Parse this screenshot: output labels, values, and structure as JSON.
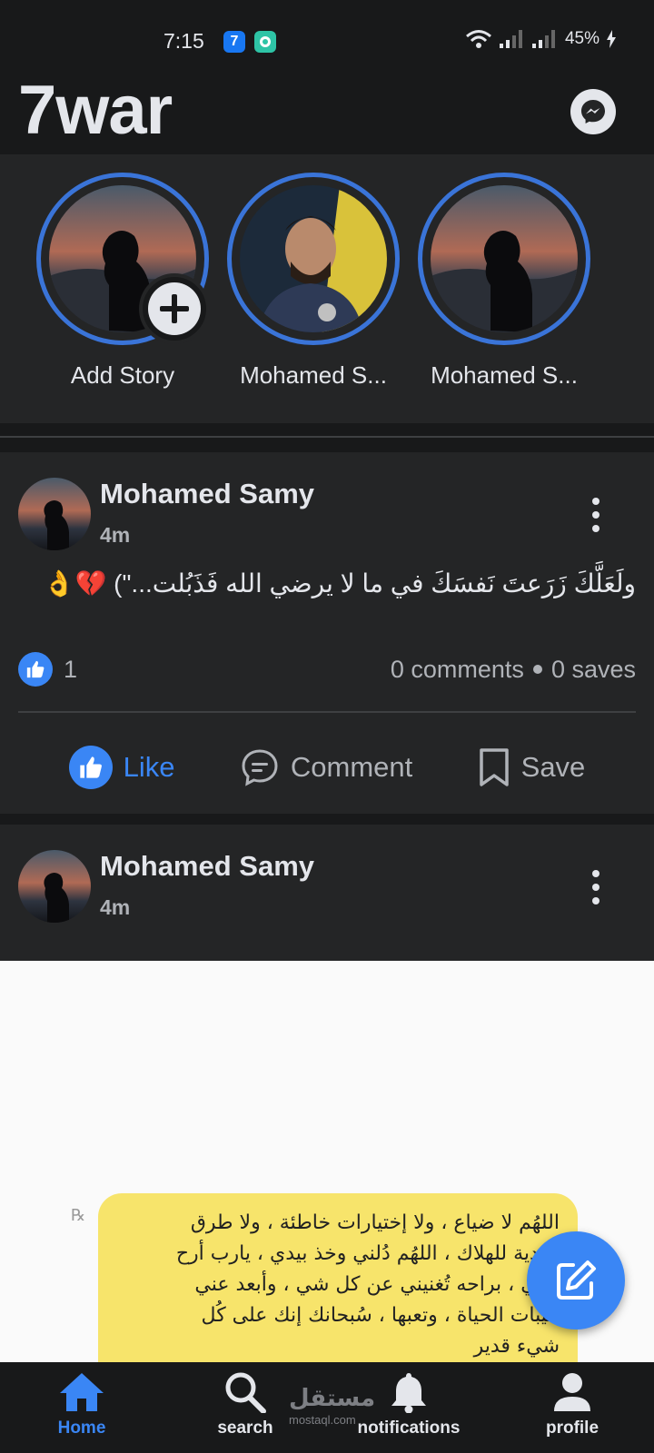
{
  "status_bar": {
    "time": "7:15",
    "badge_app": "7",
    "battery": "45%"
  },
  "header": {
    "title": "7war",
    "messenger_icon": "messenger-icon"
  },
  "stories": [
    {
      "label": "Add Story"
    },
    {
      "label": "Mohamed S..."
    },
    {
      "label": "Mohamed S..."
    }
  ],
  "posts": [
    {
      "author": "Mohamed Samy",
      "time": "4m",
      "text": "ولَعَلَّكَ زَرَعتَ نَفسَكَ في ما لا يرضي الله فَذَبُلت...\") 💔👌",
      "likes": "1",
      "comments": "0 comments",
      "saves": "0 saves",
      "actions": {
        "like": "Like",
        "comment": "Comment",
        "save": "Save"
      }
    },
    {
      "author": "Mohamed Samy",
      "time": "4m",
      "image_text": [
        "اللهُم لا ضياع ، ولا إختيارات خاطئة ، ولا طرق",
        "مُؤدية للهلاك ، اللهُم دُلني وخذ بيدي ، يارب أرح",
        "قلبي ، براحه تُغنيني عن كل شي ، وأبعد عني",
        "خيبات الحياة ، وتعبها ، سُبحانك إنك على كُل",
        "شيء قدير"
      ]
    }
  ],
  "bottom_nav": [
    {
      "label": "Home",
      "icon": "home-icon"
    },
    {
      "label": "search",
      "icon": "search-icon"
    },
    {
      "label": "notifications",
      "icon": "bell-icon"
    },
    {
      "label": "profile",
      "icon": "person-icon"
    }
  ],
  "watermark": {
    "text": "مستقل",
    "sub": "mostaql.com"
  },
  "colors": {
    "accent": "#3a86f5",
    "background": "#18191a",
    "card": "#242526"
  }
}
